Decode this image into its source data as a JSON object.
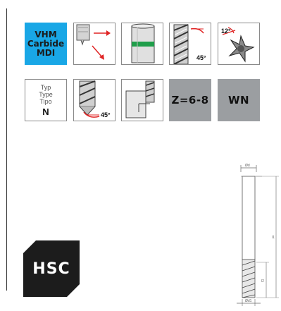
{
  "material_badge": {
    "lines": [
      "VHM",
      "Carbide",
      "MDI"
    ]
  },
  "row1_icons": [
    {
      "name": "cutting-direction-arrows-icon"
    },
    {
      "name": "shank-green-band-icon"
    },
    {
      "name": "helix-angle-45-icon",
      "angle_label": "45°"
    },
    {
      "name": "rake-angle-12-icon",
      "angle_label": "12°"
    }
  ],
  "type_tile": {
    "lines": [
      "Typ",
      "Type",
      "Tipo"
    ],
    "value": "N"
  },
  "row2_icons": [
    {
      "name": "center-cutting-45-icon",
      "angle_label": "45°"
    },
    {
      "name": "shoulder-milling-icon"
    }
  ],
  "flutes_tile": {
    "label": "Z=6-8"
  },
  "wn_tile": {
    "label": "WN"
  },
  "hsc_badge": {
    "label": "HSC"
  },
  "colors": {
    "badge_blue": "#19a7e6",
    "tile_gray": "#9b9ea1",
    "hsc_black": "#1c1c1c",
    "band_green": "#1f9e4a"
  }
}
